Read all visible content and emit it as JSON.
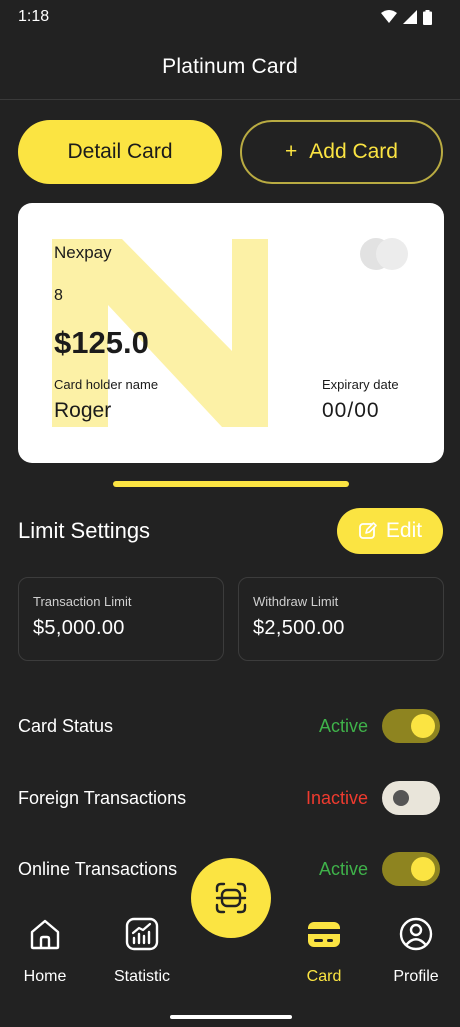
{
  "status_bar": {
    "time": "1:18",
    "icons": [
      "wifi-icon",
      "signal-icon",
      "battery-icon"
    ]
  },
  "header": {
    "title": "Platinum Card"
  },
  "actions": {
    "detail_label": "Detail Card",
    "add_icon": "+",
    "add_label": "Add Card"
  },
  "card": {
    "brand": "Nexpay",
    "number": "8",
    "balance": "$125.0",
    "holder_label": "Card holder name",
    "holder_name": "Roger",
    "expiry_label": "Expirary date",
    "expiry": "00/00"
  },
  "limits": {
    "title": "Limit Settings",
    "edit_label": "Edit",
    "transaction_label": "Transaction Limit",
    "transaction_value": "$5,000.00",
    "withdraw_label": "Withdraw Limit",
    "withdraw_value": "$2,500.00"
  },
  "settings": [
    {
      "label": "Card Status",
      "status": "Active",
      "enabled": true
    },
    {
      "label": "Foreign Transactions",
      "status": "Inactive",
      "enabled": false
    },
    {
      "label": "Online Transactions",
      "status": "Active",
      "enabled": true
    }
  ],
  "nav": [
    {
      "label": "Home",
      "icon": "home-icon",
      "active": false
    },
    {
      "label": "Statistic",
      "icon": "statistic-icon",
      "active": false
    },
    {
      "label": "Card",
      "icon": "card-icon",
      "active": true
    },
    {
      "label": "Profile",
      "icon": "profile-icon",
      "active": false
    }
  ],
  "colors": {
    "accent": "#fbe442",
    "background": "#222222",
    "active": "#3fb24a",
    "inactive": "#ef3b2f"
  }
}
